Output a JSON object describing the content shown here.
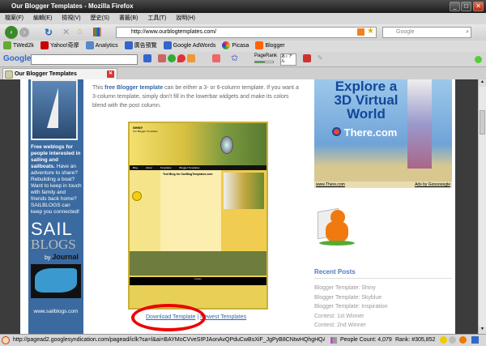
{
  "window": {
    "title": "Our Blogger Templates - Mozilla Firefox"
  },
  "menu": [
    "檔案(F)",
    "編輯(E)",
    "檢視(V)",
    "歷史(S)",
    "書籤(B)",
    "工具(T)",
    "說明(H)"
  ],
  "nav": {
    "url": "http://www.ourblogtemplates.com/",
    "search_placeholder": "Google"
  },
  "bookmarks": [
    "TWed2k",
    "Yahoo!奇摩",
    "Analytics",
    "廣告預覽",
    "Google AdWords",
    "Picasa",
    "Blogger"
  ],
  "google_toolbar": {
    "logo": "Google",
    "pagerank": "PageRank",
    "translate": "あ i ア ル"
  },
  "tab": {
    "title": "Our Blogger Templates"
  },
  "main": {
    "intro_pre": "This ",
    "intro_link": "free Blogger template",
    "intro_post": " can be either a 3- or 6-column template. If you want a 3-column template, simply don't fill in the lowerbar widgets and make its colors blend with the post column.",
    "preview": {
      "blog_title": "SHINY",
      "blog_sub": "Our Blogger Templates",
      "nav": [
        "Blog",
        "About",
        "Templates",
        "Blogger Templates"
      ],
      "post_title": "Test Blog for OurBlogTemplates.com",
      "footer": "Footer"
    },
    "download_link": "Download Template",
    "separator": "|",
    "newest_link": "Newest Templates"
  },
  "left_ad": {
    "text_bold": "Free weblogs for people interested in sailing and sailboats.",
    "text": "Have an adventure to share? Rebuilding a boat? Want to keep in touch with family and friends back home? SAILBLOGS can keep you connected!",
    "logo1": "SAIL",
    "logo2": "BLOGS",
    "by": "by",
    "journal": "Journal",
    "url": "www.sailblogs.com"
  },
  "right_ad": {
    "headline": "Explore a 3D Virtual World",
    "brand": "There.com",
    "url": "www.There.com",
    "ads_by": "Ads by Goooooogle"
  },
  "recent_posts": {
    "heading": "Recent Posts",
    "items": [
      "Blogger Template: Shiny",
      "Blogger Template: Skyblue",
      "Blogger Template: Inspiration",
      "Contest: 1st Winner",
      "Contest: 2nd Winner"
    ]
  },
  "status": {
    "url": "http://pagead2.googlesyndication.com/pagead/iclk?sa=l&ai=BAYMoCVveSIPJAonAvQPduCwBsXiF_JgPyB8CNtwHQhgHQARgBILUiKA...",
    "people_count": "People Count: 4,079",
    "rank": "Rank: #305,852"
  }
}
